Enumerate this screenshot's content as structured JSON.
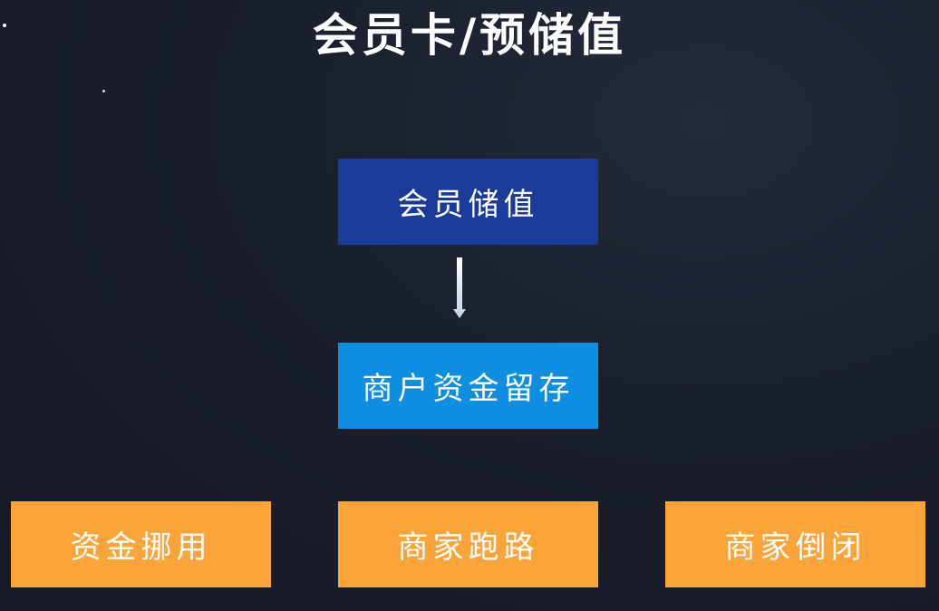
{
  "title": "会员卡/预储值",
  "nodes": {
    "member_deposit": "会员储值",
    "merchant_funds": "商户资金留存",
    "risks": [
      {
        "label": "资金挪用"
      },
      {
        "label": "商家跑路"
      },
      {
        "label": "商家倒闭"
      }
    ]
  },
  "colors": {
    "background": "#1a1f2c",
    "top_box": "#1a3b9a",
    "middle_box": "#0e8ee0",
    "risk_box": "#fba43a",
    "arrow": "#e6eef8"
  }
}
